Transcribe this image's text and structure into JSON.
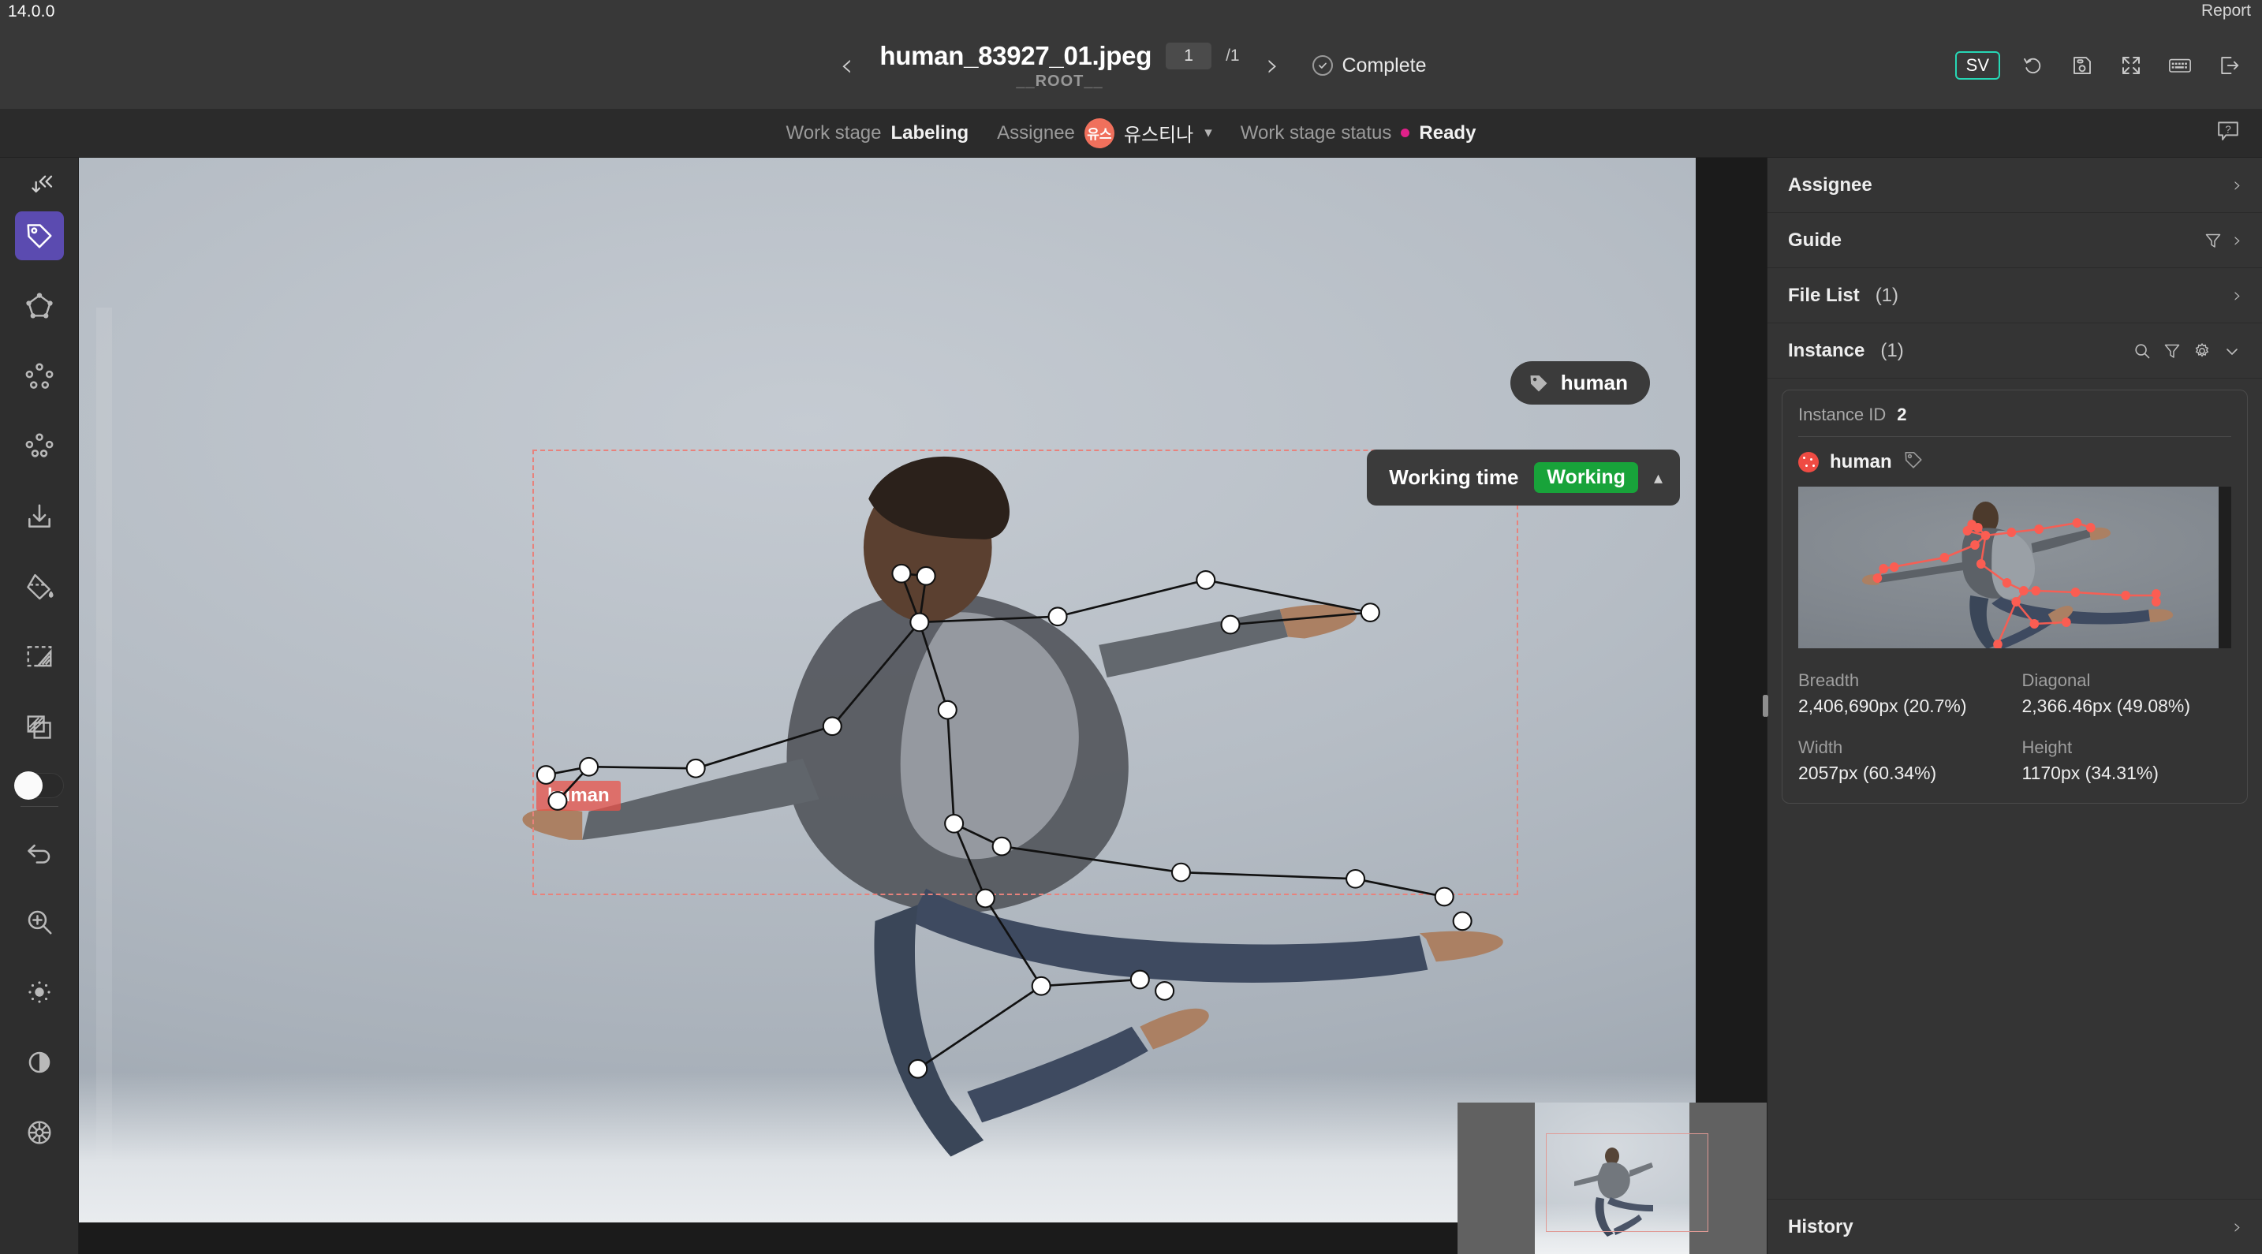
{
  "app": {
    "version": "14.0.0",
    "report_label": "Report"
  },
  "header": {
    "prev_icon": "chevron-left-icon",
    "next_icon": "chevron-right-icon",
    "file_title": "human_83927_01.jpeg",
    "page_current": "1",
    "page_total": "/1",
    "root_label": "__ROOT__",
    "status_label": "Complete",
    "sv_badge": "SV",
    "tools": [
      {
        "name": "reload-icon"
      },
      {
        "name": "save-icon"
      },
      {
        "name": "fullscreen-icon"
      },
      {
        "name": "keyboard-icon"
      },
      {
        "name": "exit-icon"
      }
    ]
  },
  "subheader": {
    "work_stage_label": "Work stage",
    "work_stage_value": "Labeling",
    "assignee_label": "Assignee",
    "assignee_initials": "유스",
    "assignee_name": "유스티나",
    "status_label": "Work stage status",
    "status_value": "Ready",
    "status_color": "#e0218a",
    "help_icon": "help-bubble-icon"
  },
  "left_toolbar": {
    "collapse_icon": "collapse-double-left-icon",
    "tools": [
      {
        "name": "tag-tool",
        "icon": "tag-icon",
        "active": true
      },
      {
        "name": "polygon-tool",
        "icon": "polygon-icon",
        "active": false
      },
      {
        "name": "keypoint-tool",
        "icon": "keypoint-cluster-icon",
        "active": false
      },
      {
        "name": "keypoint-group-tool",
        "icon": "keypoint-cluster-alt-icon",
        "active": false
      },
      {
        "name": "import-tool",
        "icon": "download-icon",
        "active": false
      },
      {
        "name": "fill-tool",
        "icon": "paint-bucket-icon",
        "active": false
      },
      {
        "name": "mask-select-tool",
        "icon": "mask-select-icon",
        "active": false
      },
      {
        "name": "layers-tool",
        "icon": "layers-icon",
        "active": false
      }
    ],
    "toggle_on": true,
    "bottom_tools": [
      {
        "name": "undo-tool",
        "icon": "undo-icon"
      },
      {
        "name": "zoom-tool",
        "icon": "zoom-in-icon"
      },
      {
        "name": "brightness-tool",
        "icon": "brightness-icon"
      },
      {
        "name": "contrast-tool",
        "icon": "contrast-icon"
      },
      {
        "name": "color-tool",
        "icon": "color-wheel-icon"
      }
    ]
  },
  "canvas": {
    "class_chip": "human",
    "class_chip_icon": "tag-icon",
    "annotation_label": "human",
    "working_time_label": "Working time",
    "working_time_status": "Working",
    "working_time_color": "#18a33a",
    "collapse_icon": "chevron-up-icon",
    "bbox_color": "#e8827c"
  },
  "right_panel": {
    "sections": [
      {
        "title": "Assignee",
        "count": "",
        "icons": [
          "chevron-right-icon"
        ]
      },
      {
        "title": "Guide",
        "count": "",
        "icons": [
          "filter-icon",
          "chevron-right-icon"
        ]
      },
      {
        "title": "File List",
        "count": "(1)",
        "icons": [
          "chevron-right-icon"
        ]
      }
    ],
    "instance_section": {
      "title": "Instance",
      "count": "(1)",
      "icons": [
        "search-icon",
        "filter-icon",
        "gear-icon",
        "chevron-down-icon"
      ]
    },
    "instance": {
      "id_label": "Instance ID",
      "id_value": "2",
      "class_name": "human",
      "class_color": "#ef4b43",
      "tag_icon": "tag-outline-icon",
      "stats": [
        {
          "label": "Breadth",
          "value": "2,406,690px (20.7%)"
        },
        {
          "label": "Diagonal",
          "value": "2,366.46px (49.08%)"
        },
        {
          "label": "Width",
          "value": "2057px (60.34%)"
        },
        {
          "label": "Height",
          "value": "1170px (34.31%)"
        }
      ]
    },
    "history": {
      "title": "History",
      "icon": "chevron-right-icon"
    }
  }
}
